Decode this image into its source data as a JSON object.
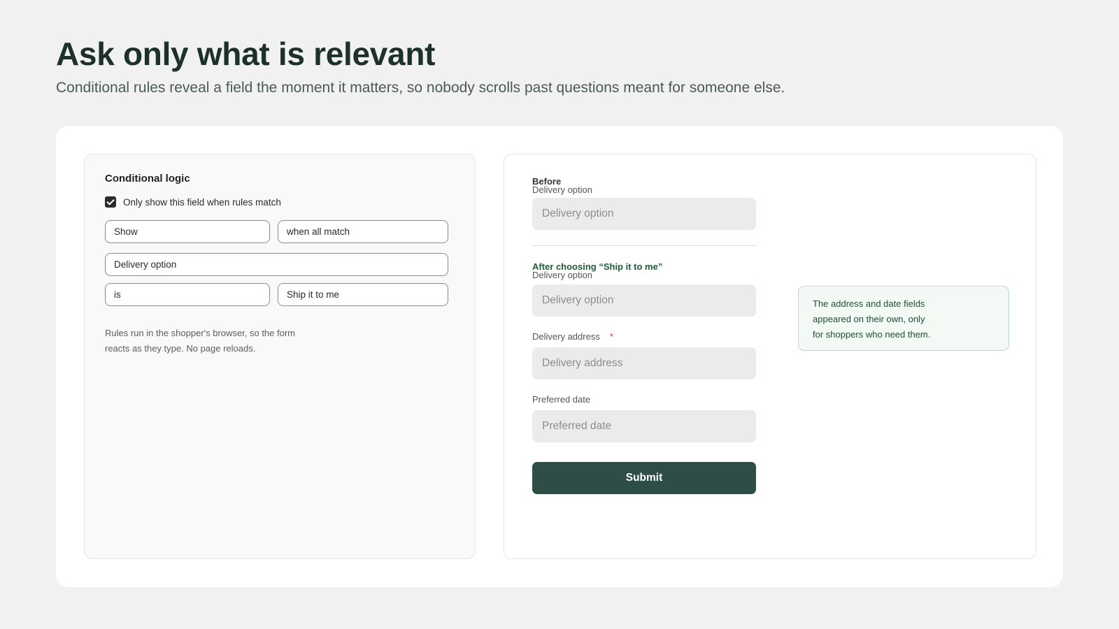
{
  "header": {
    "title": "Ask only what is relevant",
    "subtitle": "Conditional rules reveal a field the moment it matters, so nobody scrolls past questions meant for someone else."
  },
  "logic": {
    "heading": "Conditional logic",
    "checkbox_label": "Only show this field when rules match",
    "checkbox_checked": true,
    "action": "Show",
    "match_mode": "when all match",
    "field": "Delivery option",
    "operator": "is",
    "value": "Ship it to me",
    "note": "Rules run in the shopper's browser, so the form reacts as they type. No page reloads."
  },
  "preview": {
    "before": {
      "label": "Before",
      "field_label": "Delivery option",
      "field_placeholder": "Delivery option"
    },
    "after": {
      "label": "After choosing “Ship it to me”",
      "delivery_option_label": "Delivery option",
      "delivery_option_placeholder": "Delivery option",
      "address_label": "Delivery address",
      "address_required_mark": "*",
      "address_placeholder": "Delivery address",
      "date_label": "Preferred date",
      "date_placeholder": "Preferred date"
    },
    "submit_label": "Submit",
    "callout_lines": [
      "The address and date fields",
      "appeared on their own, only",
      "for shoppers who need them."
    ]
  },
  "colors": {
    "background": "#f1f1f1",
    "title": "#1c3129",
    "accent_dark": "#2d4d46",
    "accent_green_text": "#1e5c3a",
    "required": "#d23b3b",
    "callout_bg": "#f3f9f4",
    "callout_border": "#b9dec3"
  }
}
